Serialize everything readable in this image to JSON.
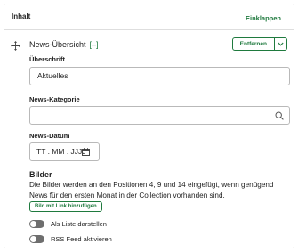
{
  "header": {
    "title": "Inhalt",
    "collapse_label": "Einklappen"
  },
  "module": {
    "title": "News-Übersicht",
    "toggle_label": "[–]",
    "move_icon": "move-icon",
    "remove_label": "Entfernen",
    "caret_icon": "chevron-down-icon"
  },
  "fields": {
    "heading": {
      "label": "Überschrift",
      "value": "Aktuelles"
    },
    "category": {
      "label": "News-Kategorie",
      "value": "",
      "icon": "search-icon"
    },
    "date": {
      "label": "News-Datum",
      "placeholder": "TT . MM . JJJJ",
      "icon": "calendar-icon"
    }
  },
  "images": {
    "heading": "Bilder",
    "description": "Die Bilder werden an den Positionen 4, 9 und 14 eingefügt, wenn genügend News für den ersten Monat in der Collection vorhanden sind.",
    "add_button_label": "Bild mit Link hinzufügen"
  },
  "toggles": [
    {
      "label": "Als Liste darstellen",
      "enabled": false
    },
    {
      "label": "RSS Feed aktivieren",
      "enabled": false
    }
  ],
  "colors": {
    "accent": "#1f7a3e",
    "border": "#b9b9b9",
    "switch_off": "#6e6e6e"
  }
}
